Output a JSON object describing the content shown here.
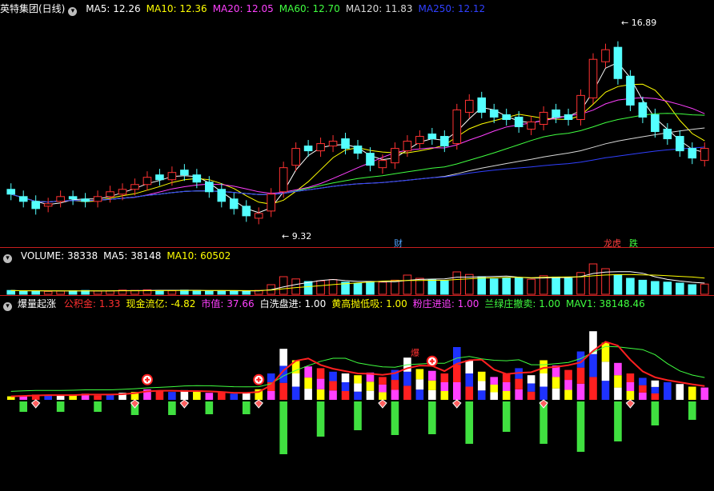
{
  "main": {
    "title": "英特集团(日线)",
    "indicators": [
      {
        "label": "MA5",
        "value": "12.26",
        "color": "#ffffff"
      },
      {
        "label": "MA10",
        "value": "12.36",
        "color": "#ffff00"
      },
      {
        "label": "MA20",
        "value": "12.05",
        "color": "#ff40ff"
      },
      {
        "label": "MA60",
        "value": "12.70",
        "color": "#40ff40"
      },
      {
        "label": "MA120",
        "value": "11.83",
        "color": "#d8d8d8"
      },
      {
        "label": "MA250",
        "value": "12.12",
        "color": "#3040ff"
      }
    ],
    "high_label": "16.89",
    "low_label": "9.32",
    "markers": [
      {
        "text": "财",
        "color": "#4fa3ff"
      },
      {
        "text": "龙虎",
        "color": "#ff4040"
      },
      {
        "text": "跌",
        "color": "#40ff40"
      }
    ]
  },
  "volume": {
    "indicators": [
      {
        "label": "VOLUME",
        "value": "38338",
        "color": "#ffffff"
      },
      {
        "label": "MA5",
        "value": "38148",
        "color": "#ffffff"
      },
      {
        "label": "MA10",
        "value": "60502",
        "color": "#ffff00"
      }
    ]
  },
  "signal": {
    "title": "爆量起涨",
    "indicators": [
      {
        "label": "公积金",
        "value": "1.33",
        "color": "#ff3030"
      },
      {
        "label": "现金流亿",
        "value": "-4.82",
        "color": "#ffff00"
      },
      {
        "label": "市值",
        "value": "37.66",
        "color": "#ff40ff"
      },
      {
        "label": "白洗盘进",
        "value": "1.00",
        "color": "#ffffff"
      },
      {
        "label": "黄高抛低吸",
        "value": "1.00",
        "color": "#ffff00"
      },
      {
        "label": "粉庄进追",
        "value": "1.00",
        "color": "#ff40ff"
      },
      {
        "label": "兰绿庄撤卖",
        "value": "1.00",
        "color": "#40ff40"
      },
      {
        "label": "MAV1",
        "value": "38148.46",
        "color": "#40ff40"
      }
    ],
    "burst_label": "爆"
  },
  "chart_data": [
    {
      "type": "candlestick",
      "panel": "price",
      "high": 16.89,
      "low": 9.32,
      "ylim": [
        8.5,
        17.8
      ],
      "series": [
        {
          "name": "MA5",
          "values": [
            12.26
          ]
        },
        {
          "name": "MA10",
          "values": [
            12.36
          ]
        },
        {
          "name": "MA20",
          "values": [
            12.05
          ]
        },
        {
          "name": "MA60",
          "values": [
            12.7
          ]
        },
        {
          "name": "MA120",
          "values": [
            11.83
          ]
        },
        {
          "name": "MA250",
          "values": [
            12.12
          ]
        }
      ],
      "close": [
        10.4,
        10.1,
        9.8,
        10.0,
        10.3,
        10.2,
        10.1,
        10.3,
        10.5,
        10.6,
        10.8,
        11.1,
        11.0,
        11.3,
        11.2,
        10.9,
        10.5,
        10.1,
        9.8,
        9.5,
        9.6,
        10.4,
        11.5,
        12.3,
        12.2,
        12.5,
        12.6,
        12.3,
        12.1,
        11.6,
        11.8,
        12.3,
        12.6,
        12.8,
        12.7,
        12.4,
        13.9,
        14.3,
        13.8,
        13.6,
        13.5,
        13.2,
        13.4,
        13.8,
        13.6,
        13.5,
        14.5,
        16.0,
        16.4,
        15.2,
        14.1,
        13.6,
        13.0,
        12.7,
        12.2,
        11.9,
        12.3
      ],
      "open": [
        10.6,
        10.3,
        10.1,
        9.9,
        10.1,
        10.3,
        10.2,
        10.1,
        10.3,
        10.4,
        10.6,
        10.8,
        11.2,
        11.0,
        11.4,
        11.2,
        10.9,
        10.6,
        10.2,
        9.9,
        9.4,
        9.7,
        10.5,
        11.6,
        12.4,
        12.2,
        12.4,
        12.7,
        12.4,
        12.1,
        11.5,
        11.7,
        12.2,
        12.5,
        12.9,
        12.8,
        12.5,
        13.8,
        14.4,
        13.9,
        13.7,
        13.6,
        13.1,
        13.3,
        13.9,
        13.7,
        13.5,
        14.4,
        15.9,
        16.5,
        15.3,
        14.2,
        13.7,
        13.1,
        12.8,
        12.3,
        11.8
      ]
    },
    {
      "type": "bar",
      "panel": "volume",
      "series": [
        {
          "name": "VOLUME",
          "values": [
            38338
          ]
        },
        {
          "name": "MA5",
          "values": [
            38148
          ]
        },
        {
          "name": "MA10",
          "values": [
            60502
          ]
        }
      ],
      "values": [
        12,
        10,
        11,
        9,
        10,
        11,
        12,
        10,
        11,
        13,
        12,
        14,
        12,
        11,
        13,
        12,
        10,
        11,
        10,
        9,
        12,
        30,
        55,
        48,
        40,
        42,
        46,
        38,
        35,
        40,
        38,
        44,
        60,
        50,
        45,
        42,
        70,
        62,
        55,
        48,
        50,
        52,
        47,
        58,
        54,
        50,
        68,
        95,
        80,
        60,
        50,
        44,
        40,
        38,
        35,
        30,
        32
      ]
    },
    {
      "type": "bar",
      "panel": "signal",
      "series": [
        {
          "name": "MAV1",
          "values": [
            38148.46
          ]
        }
      ],
      "values": [
        0.4,
        0.5,
        0.6,
        0.5,
        0.5,
        0.6,
        0.7,
        0.5,
        0.6,
        0.8,
        0.9,
        1.2,
        1.0,
        0.9,
        1.1,
        1.0,
        0.8,
        0.9,
        0.7,
        0.8,
        1.2,
        3.0,
        5.8,
        4.5,
        3.8,
        3.6,
        3.2,
        3.0,
        2.8,
        3.1,
        2.6,
        3.4,
        4.8,
        3.5,
        3.3,
        3.0,
        6.0,
        4.5,
        3.2,
        2.6,
        3.0,
        3.6,
        2.8,
        4.5,
        3.9,
        3.4,
        5.5,
        7.8,
        6.5,
        4.2,
        3.0,
        2.5,
        2.2,
        2.0,
        1.8,
        1.5,
        1.4
      ]
    }
  ]
}
